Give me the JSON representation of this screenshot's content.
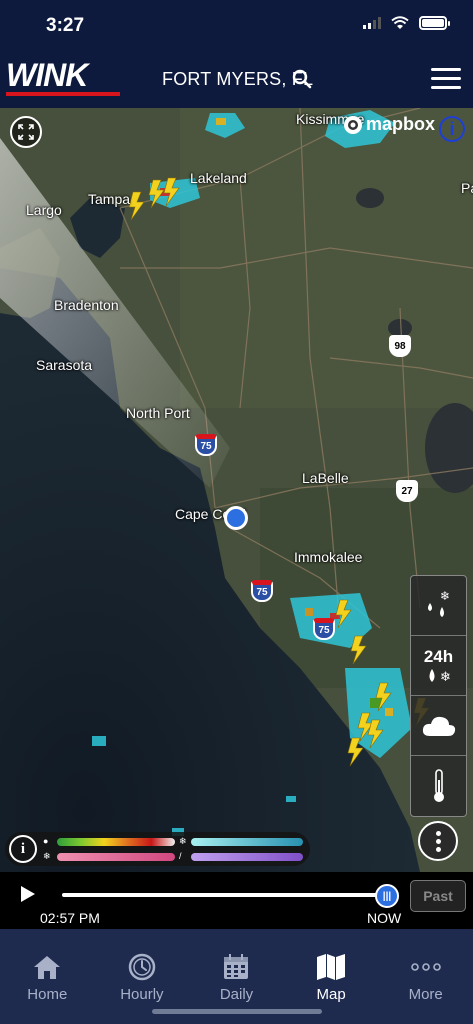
{
  "status_bar": {
    "time": "3:27"
  },
  "header": {
    "logo": "WINK",
    "location": "FORT MYERS, FL"
  },
  "map": {
    "attribution": "mapbox",
    "places": [
      {
        "id": "kissimmee",
        "label": "Kissimmee"
      },
      {
        "id": "lakeland",
        "label": "Lakeland"
      },
      {
        "id": "tampa",
        "label": "Tampa"
      },
      {
        "id": "largo",
        "label": "Largo"
      },
      {
        "id": "bradenton",
        "label": "Bradenton"
      },
      {
        "id": "sarasota",
        "label": "Sarasota"
      },
      {
        "id": "north-port",
        "label": "North Port"
      },
      {
        "id": "labelle",
        "label": "LaBelle"
      },
      {
        "id": "cape-coral",
        "label": "Cape Coral"
      },
      {
        "id": "immokalee",
        "label": "Immokalee"
      },
      {
        "id": "edge-pa",
        "label": "Pa"
      }
    ],
    "highways": [
      {
        "id": "i75-north",
        "label": "75",
        "kind": "interstate"
      },
      {
        "id": "i75-mid",
        "label": "75",
        "kind": "interstate"
      },
      {
        "id": "i75-south",
        "label": "75",
        "kind": "interstate"
      },
      {
        "id": "us98",
        "label": "98",
        "kind": "us"
      },
      {
        "id": "us27",
        "label": "27",
        "kind": "us"
      }
    ],
    "layer_panel": {
      "hour_label": "24h"
    }
  },
  "timeline": {
    "start_time": "02:57 PM",
    "now_label": "NOW",
    "past_label": "Past",
    "progress": 1.0
  },
  "nav": {
    "items": [
      {
        "label": "Home",
        "icon": "home-icon"
      },
      {
        "label": "Hourly",
        "icon": "clock-icon"
      },
      {
        "label": "Daily",
        "icon": "calendar-icon"
      },
      {
        "label": "Map",
        "icon": "map-icon"
      },
      {
        "label": "More",
        "icon": "more-dots-icon"
      }
    ],
    "active": "Map"
  },
  "colors": {
    "brand_navy": "#0d1a3d",
    "nav_bg": "#1e2b4f",
    "accent_blue": "#2c6fe0",
    "logo_red": "#d8151c"
  }
}
